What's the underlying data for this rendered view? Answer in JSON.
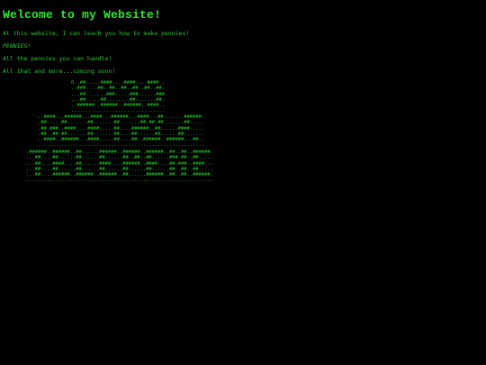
{
  "page": {
    "heading": "Welcome to my Website!",
    "paragraphs": [
      "At this website, I can teach you how to make pennies!",
      "PENNIES!",
      "All the pennies you can handle!",
      "All that and more...coming soon!"
    ]
  },
  "ascii_art": {
    "block1": [
      "0..##.....####....####....####..",
      "..###....##..##..##..##..##..##.",
      "...##.......###.....###......###.",
      "...##.....##........##.......##.",
      "..######..######..######..####..",
      "................................"
    ],
    "block2": [
      "..####...######...####...######...####...##.......######.",
      ".##.....##.......##.......##.......##.##.##.......##.....",
      ".##.###..####....####.....##....######..##......####.....",
      ".##..##.##.......##.......##....##......##......##.......",
      "..####..######...####.....##....##..######..######...##..",
      "........................................................."
    ],
    "block3": [
      ".######..######..##......######..######..######..##..##..######.",
      "...##....##......##......##......##..##..##......###.##..##.....",
      "...##....####....##......####....######..####....##.###..####...",
      "...##....##......##......##......##......##......##..##..##.....",
      "...##....######..######..######..##......######..##..##..######.",
      "................................................................"
    ]
  },
  "colors": {
    "background": "#000000",
    "text": "#22c82a",
    "heading": "#2ee830"
  }
}
